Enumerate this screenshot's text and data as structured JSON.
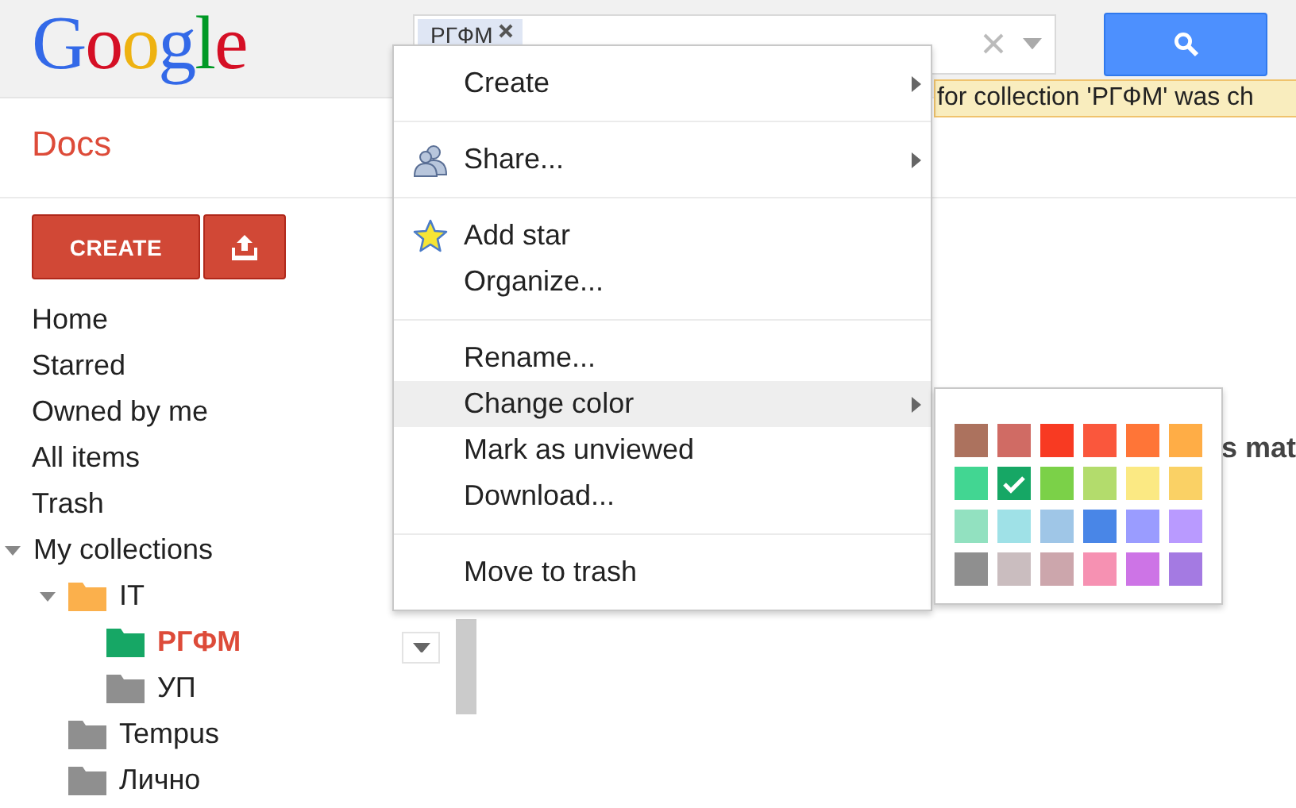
{
  "header": {
    "logo": "Google",
    "search": {
      "chips": [
        {
          "label": "РГФМ"
        }
      ]
    }
  },
  "app_title": "Docs",
  "notice": "for collection 'РГФМ' was ch",
  "sidebar": {
    "create_button": "CREATE",
    "nav": [
      {
        "label": "Home",
        "selected": false
      },
      {
        "label": "Starred",
        "selected": false
      },
      {
        "label": "Owned by me",
        "selected": false
      },
      {
        "label": "All items",
        "selected": false
      },
      {
        "label": "Trash",
        "selected": false
      }
    ],
    "tree": [
      {
        "label": "My collections",
        "expanded": true,
        "selected": false,
        "children": [
          {
            "label": "IT",
            "kind": "folder",
            "color": "#fbb04c",
            "expanded": true,
            "selected": false,
            "children": [
              {
                "label": "РГФМ",
                "kind": "folder",
                "color": "#16a765",
                "selected": true
              },
              {
                "label": "УП",
                "kind": "folder",
                "color": "#8f8f8f",
                "selected": false
              }
            ]
          },
          {
            "label": "Tempus",
            "kind": "folder",
            "color": "#8f8f8f",
            "selected": false
          },
          {
            "label": "Лично",
            "kind": "folder",
            "color": "#8f8f8f",
            "selected": false
          }
        ]
      }
    ]
  },
  "main_text": "s mat",
  "context_menu": {
    "groups": [
      {
        "items": [
          {
            "label": "Create",
            "kind": "plain",
            "submenu": true,
            "highlighted": false
          }
        ]
      },
      {
        "items": [
          {
            "label": "Share...",
            "kind": "share",
            "submenu": true,
            "highlighted": false
          }
        ]
      },
      {
        "items": [
          {
            "label": "Add star",
            "kind": "star",
            "submenu": false,
            "highlighted": false
          },
          {
            "label": "Organize...",
            "kind": "plain",
            "submenu": false,
            "highlighted": false
          }
        ]
      },
      {
        "items": [
          {
            "label": "Rename...",
            "kind": "plain",
            "submenu": false,
            "highlighted": false
          },
          {
            "label": "Change color",
            "kind": "plain",
            "submenu": true,
            "highlighted": true
          },
          {
            "label": "Mark as unviewed",
            "kind": "plain",
            "submenu": false,
            "highlighted": false
          },
          {
            "label": "Download...",
            "kind": "plain",
            "submenu": false,
            "highlighted": false
          }
        ]
      },
      {
        "items": [
          {
            "label": "Move to trash",
            "kind": "plain",
            "submenu": false,
            "highlighted": false
          }
        ]
      }
    ]
  },
  "palette": {
    "colors": [
      {
        "color": "#ac725e",
        "checked": false
      },
      {
        "color": "#d06b64",
        "checked": false
      },
      {
        "color": "#f83a22",
        "checked": false
      },
      {
        "color": "#fa573c",
        "checked": false
      },
      {
        "color": "#ff7537",
        "checked": false
      },
      {
        "color": "#ffad46",
        "checked": false
      },
      {
        "color": "#42d692",
        "checked": false
      },
      {
        "color": "#16a765",
        "checked": true
      },
      {
        "color": "#7bd148",
        "checked": false
      },
      {
        "color": "#b3dc6c",
        "checked": false
      },
      {
        "color": "#fbe983",
        "checked": false
      },
      {
        "color": "#fad165",
        "checked": false
      },
      {
        "color": "#92e1c0",
        "checked": false
      },
      {
        "color": "#9fe1e7",
        "checked": false
      },
      {
        "color": "#9fc6e7",
        "checked": false
      },
      {
        "color": "#4986e7",
        "checked": false
      },
      {
        "color": "#9a9cff",
        "checked": false
      },
      {
        "color": "#b99aff",
        "checked": false
      },
      {
        "color": "#8f8f8f",
        "checked": false
      },
      {
        "color": "#cabdbf",
        "checked": false
      },
      {
        "color": "#cca6ac",
        "checked": false
      },
      {
        "color": "#f691b2",
        "checked": false
      },
      {
        "color": "#cd74e6",
        "checked": false
      },
      {
        "color": "#a47ae2",
        "checked": false
      }
    ]
  }
}
